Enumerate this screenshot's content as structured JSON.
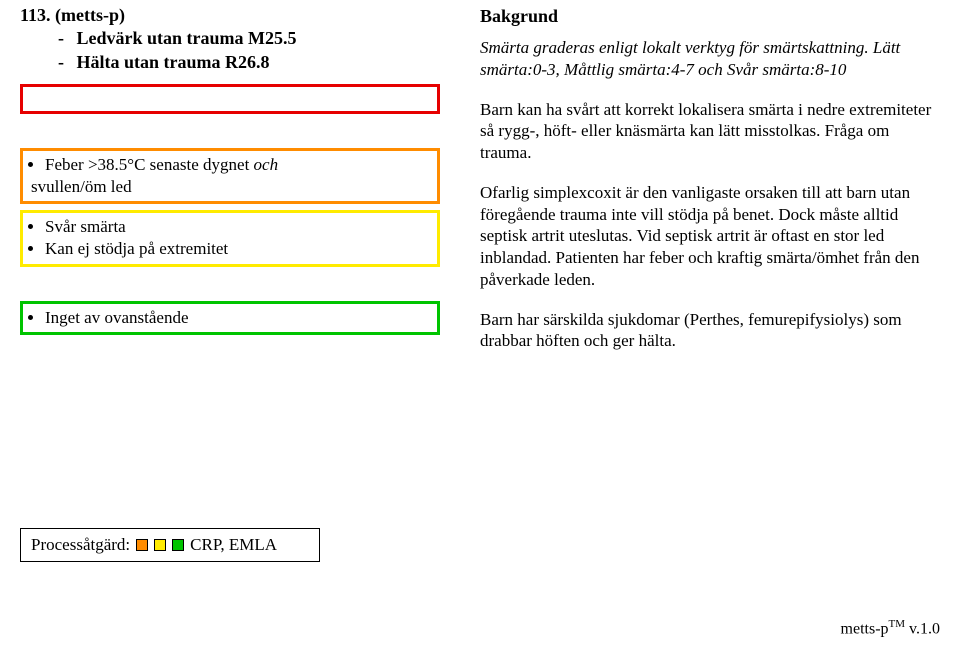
{
  "header": {
    "code": "113.",
    "name": "(metts-p)",
    "line1_prefix": "-",
    "line1": "Ledvärk utan trauma M25.5",
    "line2_prefix": "-",
    "line2": "Hälta utan trauma R26.8"
  },
  "triage": {
    "orange": {
      "item1a": "Feber >38.5°C senaste dygnet ",
      "item1b_ital": "och",
      "item2": "svullen/öm led"
    },
    "yellow": {
      "item1": "Svår smärta",
      "item2": "Kan ej stödja på extremitet"
    },
    "green": {
      "item1": "Inget av ovanstående"
    }
  },
  "background": {
    "heading": "Bakgrund",
    "p1_ital": "Smärta graderas enligt lokalt verktyg för smärtskattning. Lätt smärta:0-3, Måttlig smärta:4-7 och Svår smärta:8-10",
    "p2": "Barn kan ha svårt att korrekt lokalisera smärta i nedre extremiteter så rygg-, höft- eller knäsmärta kan lätt misstolkas. Fråga om trauma.",
    "p3": "Ofarlig simplexcoxit är den vanligaste orsaken till att barn utan föregående trauma inte vill stödja på benet. Dock måste alltid septisk artrit uteslutas. Vid septisk artrit är oftast en stor led inblandad. Patienten har feber och kraftig smärta/ömhet från den påverkade leden.",
    "p4": "Barn har särskilda sjukdomar (Perthes, femurepifysiolys) som drabbar höften och ger hälta."
  },
  "process": {
    "label": "Processåtgärd:",
    "value": "CRP, EMLA"
  },
  "footer": {
    "text_a": "metts-p",
    "tm": "TM",
    "text_b": " v.1.0"
  }
}
